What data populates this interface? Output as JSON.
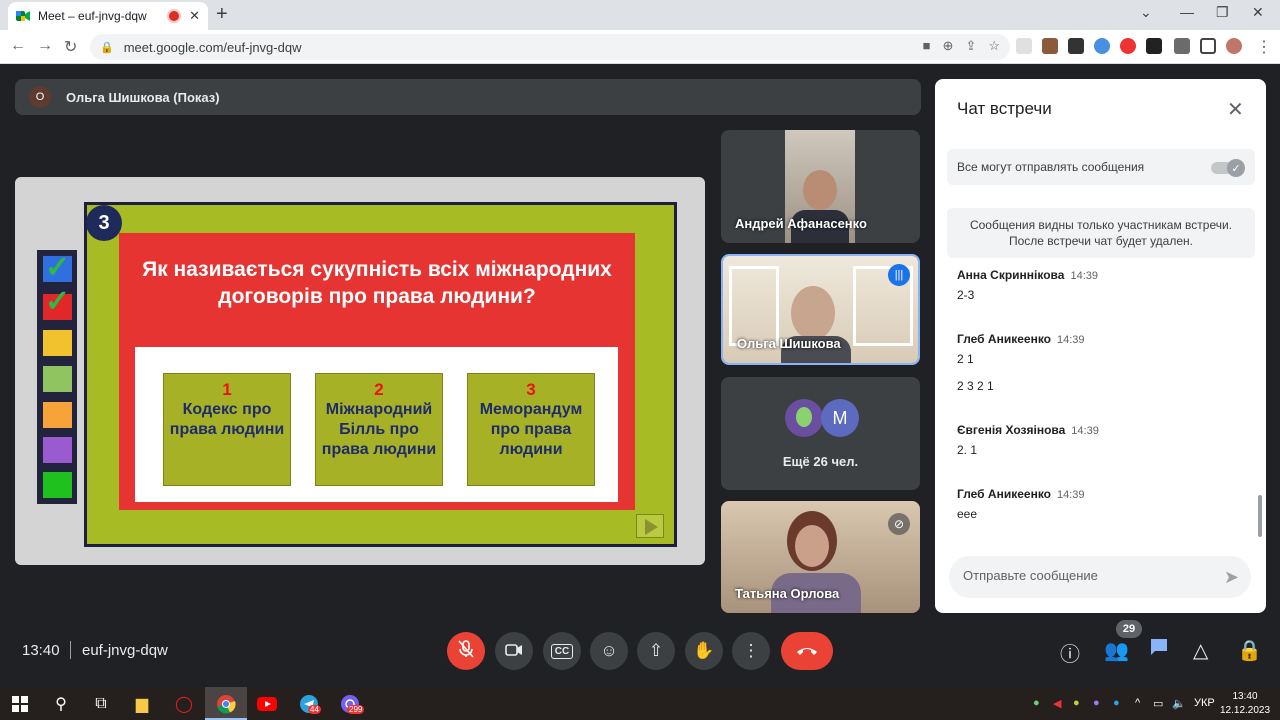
{
  "browser": {
    "tab_title": "Meet – euf-jnvg-dqw",
    "url": "meet.google.com/euf-jnvg-dqw"
  },
  "presenting": {
    "avatar_letter": "О",
    "label": "Ольга Шишкова (Показ)"
  },
  "slide": {
    "number": "3",
    "question": "Як називається сукупність всіх міжнародних договорів про права людини?",
    "answers": [
      {
        "num": "1",
        "text": "Кодекс про права людини"
      },
      {
        "num": "2",
        "text": "Міжнародний Білль про права людини"
      },
      {
        "num": "3",
        "text": "Меморандум про права людини"
      }
    ],
    "strip_colors": [
      "#2f6fe0",
      "#e0282a",
      "#f2c12e",
      "#8fc460",
      "#f7a33a",
      "#9b5bd0",
      "#1fc11f"
    ]
  },
  "participants": [
    {
      "name": "Андрей Афанасенко"
    },
    {
      "name": "Ольга Шишкова"
    },
    {
      "name": "Ещё 26 чел.",
      "avatar_letter": "M"
    },
    {
      "name": "Татьяна Орлова"
    }
  ],
  "chat": {
    "title": "Чат встречи",
    "toggle_label": "Все могут отправлять сообщения",
    "notice_line1": "Сообщения видны только участникам встречи.",
    "notice_line2": "После встречи чат будет удален.",
    "messages": [
      {
        "sender": "Анна Скриннікова",
        "time": "14:39",
        "lines": [
          "2-3"
        ]
      },
      {
        "sender": "Глеб Аникеенко",
        "time": "14:39",
        "lines": [
          "2 1",
          "2 3 2 1"
        ]
      },
      {
        "sender": "Євгенія Хозяінова",
        "time": "14:39",
        "lines": [
          "2. 1"
        ]
      },
      {
        "sender": "Глеб Аникеенко",
        "time": "14:39",
        "lines": [
          "еее"
        ]
      }
    ],
    "input_placeholder": "Отправьте сообщение"
  },
  "meeting": {
    "time": "13:40",
    "code": "euf-jnvg-dqw",
    "participant_count": "29"
  },
  "taskbar": {
    "lang": "УКР",
    "time": "13:40",
    "date": "12.12.2023",
    "telegram_badge": "44",
    "viber_badge": "299"
  }
}
